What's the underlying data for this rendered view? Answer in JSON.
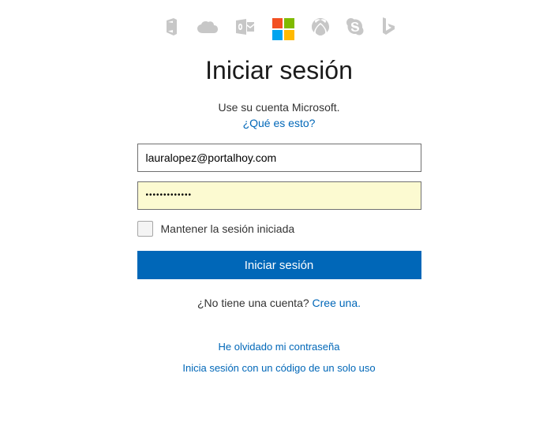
{
  "icons": {
    "office": "office-icon",
    "onedrive": "onedrive-icon",
    "outlook": "outlook-icon",
    "microsoft": "microsoft-logo",
    "xbox": "xbox-icon",
    "skype": "skype-icon",
    "bing": "bing-icon"
  },
  "header": {
    "title": "Iniciar sesión",
    "subtitle": "Use su cuenta Microsoft.",
    "help_link": "¿Qué es esto?"
  },
  "form": {
    "email_value": "lauralopez@portalhoy.com",
    "password_value": "•••••••••••••",
    "keep_signed_label": "Mantener la sesión iniciada",
    "signin_button": "Iniciar sesión"
  },
  "no_account": {
    "question": "¿No tiene una cuenta? ",
    "create_link": "Cree una."
  },
  "footer": {
    "forgot_password": "He olvidado mi contraseña",
    "single_use_code": "Inicia sesión con un código de un solo uso"
  },
  "colors": {
    "link": "#0067b8",
    "button_bg": "#0067b8",
    "autofill_bg": "#fcfad1"
  }
}
